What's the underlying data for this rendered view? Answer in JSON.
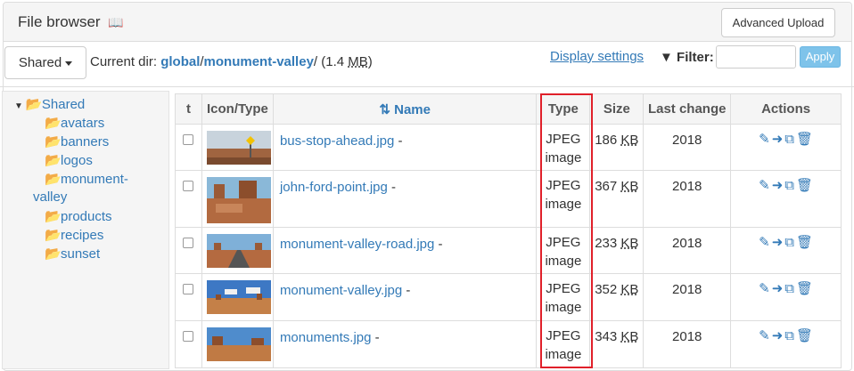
{
  "header": {
    "title": "File browser",
    "book_icon": "book-icon",
    "advanced_upload_label": "Advanced Upload"
  },
  "toolbar": {
    "shared_label": "Shared",
    "current_dir_label": "Current dir:",
    "path_parts": [
      "global",
      "monument-valley"
    ],
    "dir_size_prefix": "(1.4 ",
    "dir_size_unit": "MB",
    "dir_size_suffix": ")",
    "display_settings_label": "Display settings",
    "filter_label": "Filter:",
    "filter_value": "",
    "apply_label": "Apply"
  },
  "tree": {
    "root": "Shared",
    "items": [
      "avatars",
      "banners",
      "logos",
      "monument-",
      "valley",
      "products",
      "recipes",
      "sunset"
    ]
  },
  "table": {
    "headers": {
      "sort_icon": "t",
      "icon_type": "Icon/Type",
      "name": "Name",
      "type": "Type",
      "size": "Size",
      "last_change": "Last change",
      "actions": "Actions"
    },
    "rows": [
      {
        "name": "bus-stop-ahead.jpg",
        "suffix": " -",
        "type1": "JPEG",
        "type2": "image",
        "size": "186",
        "unit": "KB",
        "date": "2018"
      },
      {
        "name": "john-ford-point.jpg",
        "suffix": " -",
        "type1": "JPEG",
        "type2": "image",
        "size": "367",
        "unit": "KB",
        "date": "2018"
      },
      {
        "name": "monument-valley-road.jpg",
        "suffix": " -",
        "type1": "JPEG",
        "type2": "image",
        "size": "233",
        "unit": "KB",
        "date": "2018"
      },
      {
        "name": "monument-valley.jpg",
        "suffix": " -",
        "type1": "JPEG",
        "type2": "image",
        "size": "352",
        "unit": "KB",
        "date": "2018"
      },
      {
        "name": "monuments.jpg",
        "suffix": " -",
        "type1": "JPEG",
        "type2": "image",
        "size": "343",
        "unit": "KB",
        "date": "2018"
      }
    ]
  },
  "colors": {
    "link": "#337ab7",
    "highlight": "#e0202a",
    "apply": "#7ec3ea"
  }
}
